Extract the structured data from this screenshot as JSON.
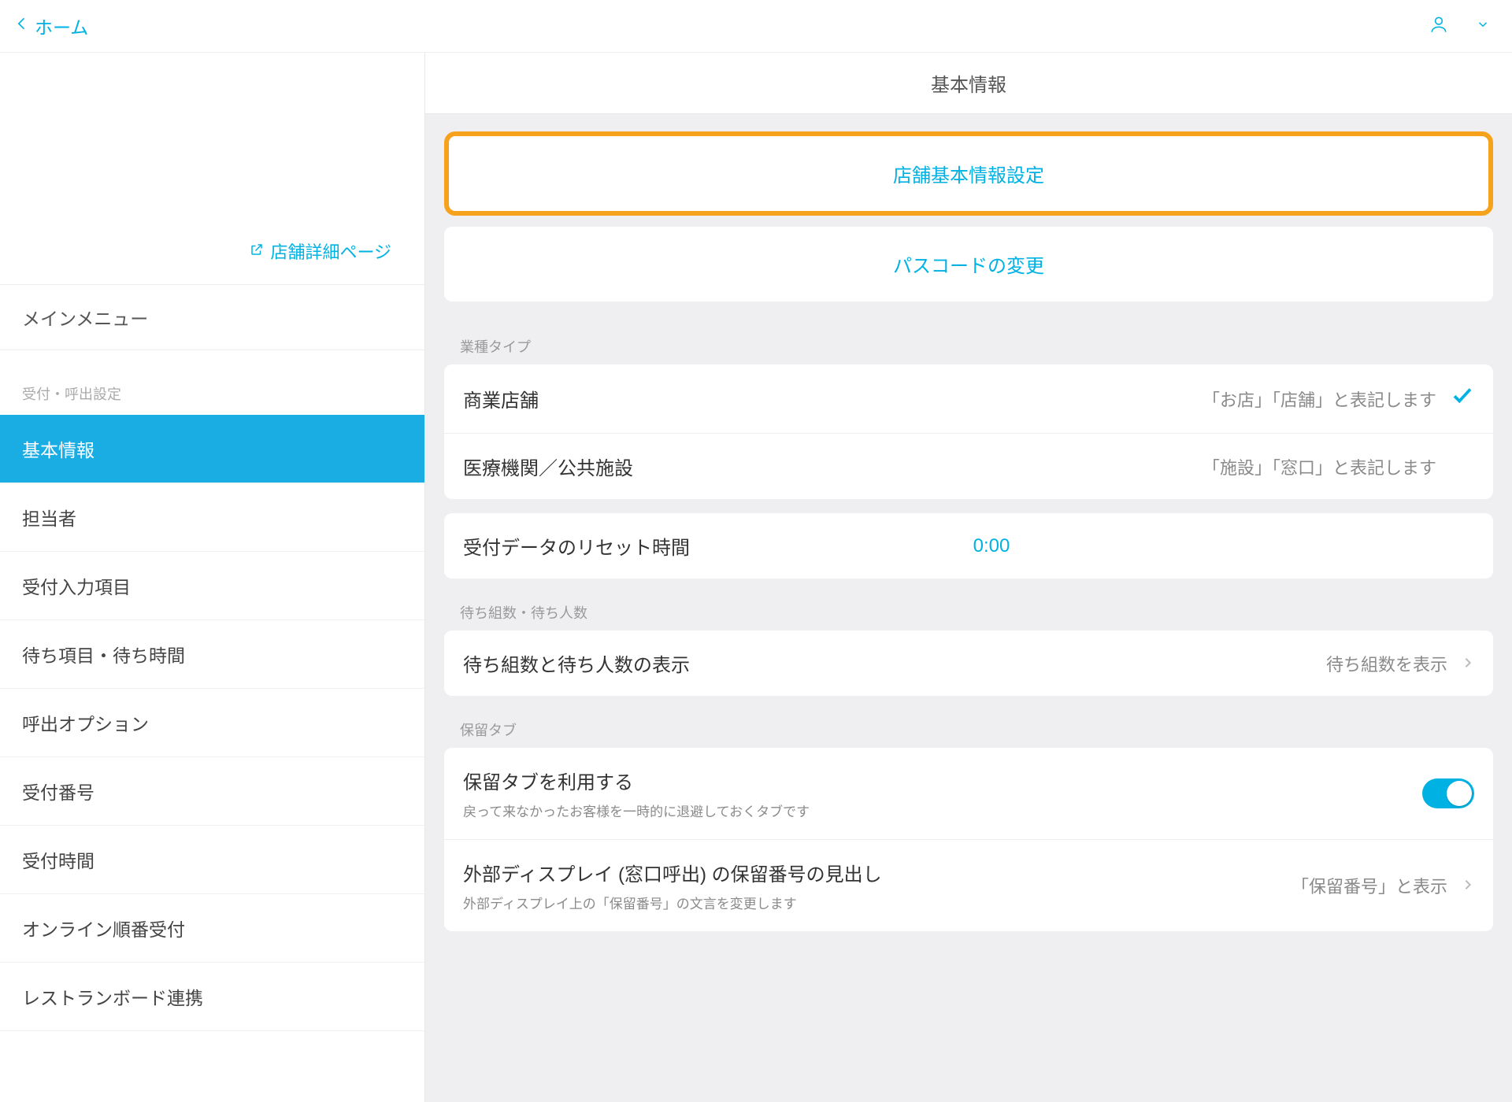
{
  "topbar": {
    "home_label": "ホーム"
  },
  "sidebar": {
    "shop_link": "店舗詳細ページ",
    "main_menu_label": "メインメニュー",
    "section_label": "受付・呼出設定",
    "items": [
      {
        "label": "基本情報"
      },
      {
        "label": "担当者"
      },
      {
        "label": "受付入力項目"
      },
      {
        "label": "待ち項目・待ち時間"
      },
      {
        "label": "呼出オプション"
      },
      {
        "label": "受付番号"
      },
      {
        "label": "受付時間"
      },
      {
        "label": "オンライン順番受付"
      },
      {
        "label": "レストランボード連携"
      }
    ]
  },
  "main": {
    "page_title": "基本情報",
    "card_shop_settings": "店舗基本情報設定",
    "card_passcode": "パスコードの変更",
    "biz_type_label": "業種タイプ",
    "biz_type_rows": [
      {
        "title": "商業店舗",
        "desc": "「お店」「店舗」と表記します",
        "selected": true
      },
      {
        "title": "医療機関／公共施設",
        "desc": "「施設」「窓口」と表記します",
        "selected": false
      }
    ],
    "reset_row": {
      "title": "受付データのリセット時間",
      "value": "0:00"
    },
    "wait_label": "待ち組数・待ち人数",
    "wait_row": {
      "title": "待ち組数と待ち人数の表示",
      "value": "待ち組数を表示"
    },
    "hold_label": "保留タブ",
    "hold_row1": {
      "title": "保留タブを利用する",
      "sub": "戻って来なかったお客様を一時的に退避しておくタブです"
    },
    "hold_row2": {
      "title": "外部ディスプレイ (窓口呼出) の保留番号の見出し",
      "sub": "外部ディスプレイ上の「保留番号」の文言を変更します",
      "value": "「保留番号」と表示"
    }
  }
}
